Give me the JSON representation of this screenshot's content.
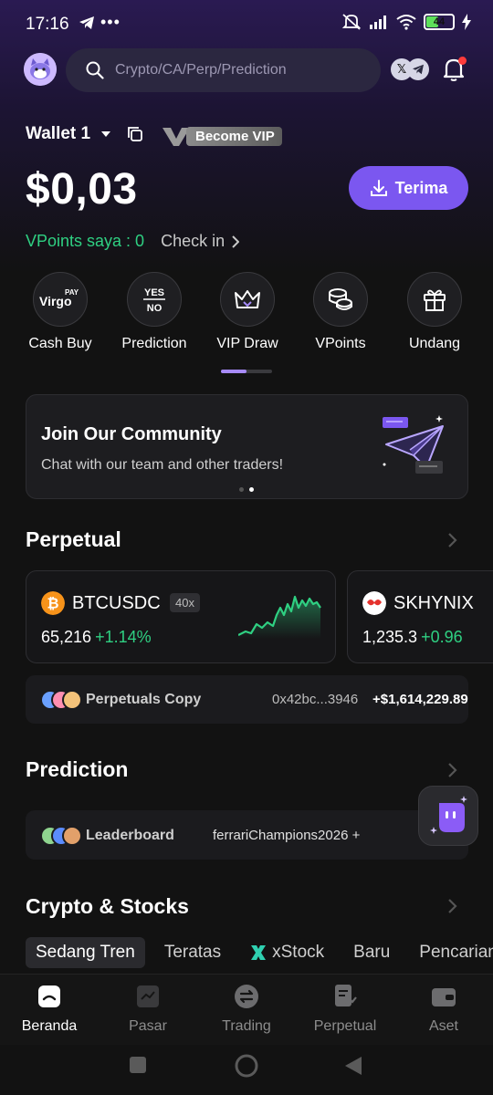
{
  "status_bar": {
    "time": "17:16",
    "battery": "44"
  },
  "search": {
    "placeholder": "Crypto/CA/Perp/Prediction"
  },
  "wallet": {
    "name": "Wallet 1",
    "vip_label": "Become VIP",
    "balance": "$0,03",
    "receive_label": "Terima",
    "vpoints_text": "VPoints saya : 0",
    "checkin_label": "Check in"
  },
  "actions": [
    {
      "label": "Cash Buy",
      "icon": "virgo-pay-icon"
    },
    {
      "label": "Prediction",
      "icon": "yes-no-icon"
    },
    {
      "label": "VIP Draw",
      "icon": "crown-icon"
    },
    {
      "label": "VPoints",
      "icon": "coins-icon"
    },
    {
      "label": "Undang",
      "icon": "gift-icon"
    }
  ],
  "action_icons_text": {
    "virgo": "Virgo",
    "pay": "PAY",
    "yes": "YES",
    "no": "NO"
  },
  "banner": {
    "title": "Join Our Community",
    "subtitle": "Chat with our team and other traders!"
  },
  "perpetual": {
    "title": "Perpetual",
    "cards": [
      {
        "symbol": "BTCUSDC",
        "leverage": "40x",
        "price": "65,216",
        "change": "+1.14%"
      },
      {
        "symbol": "SKHYNIX",
        "leverage": "",
        "price": "1,235.3",
        "change": "+0.96"
      }
    ],
    "copy": {
      "label": "Perpetuals Copy",
      "address": "0x42bc...3946",
      "amount": "+$1,614,229.89"
    }
  },
  "prediction": {
    "title": "Prediction",
    "leaderboard": {
      "label": "Leaderboard",
      "entry": "ferrariChampions2026 +"
    }
  },
  "crypto_stocks": {
    "title": "Crypto & Stocks",
    "tabs": [
      "Sedang Tren",
      "Teratas",
      "xStock",
      "Baru",
      "Pencarian"
    ]
  },
  "bottom_nav": [
    {
      "label": "Beranda",
      "active": true
    },
    {
      "label": "Pasar",
      "active": false
    },
    {
      "label": "Trading",
      "active": false
    },
    {
      "label": "Perpetual",
      "active": false
    },
    {
      "label": "Aset",
      "active": false
    }
  ],
  "colors": {
    "accent": "#7b57f0",
    "positive": "#2fd082",
    "btc": "#f7931a"
  }
}
